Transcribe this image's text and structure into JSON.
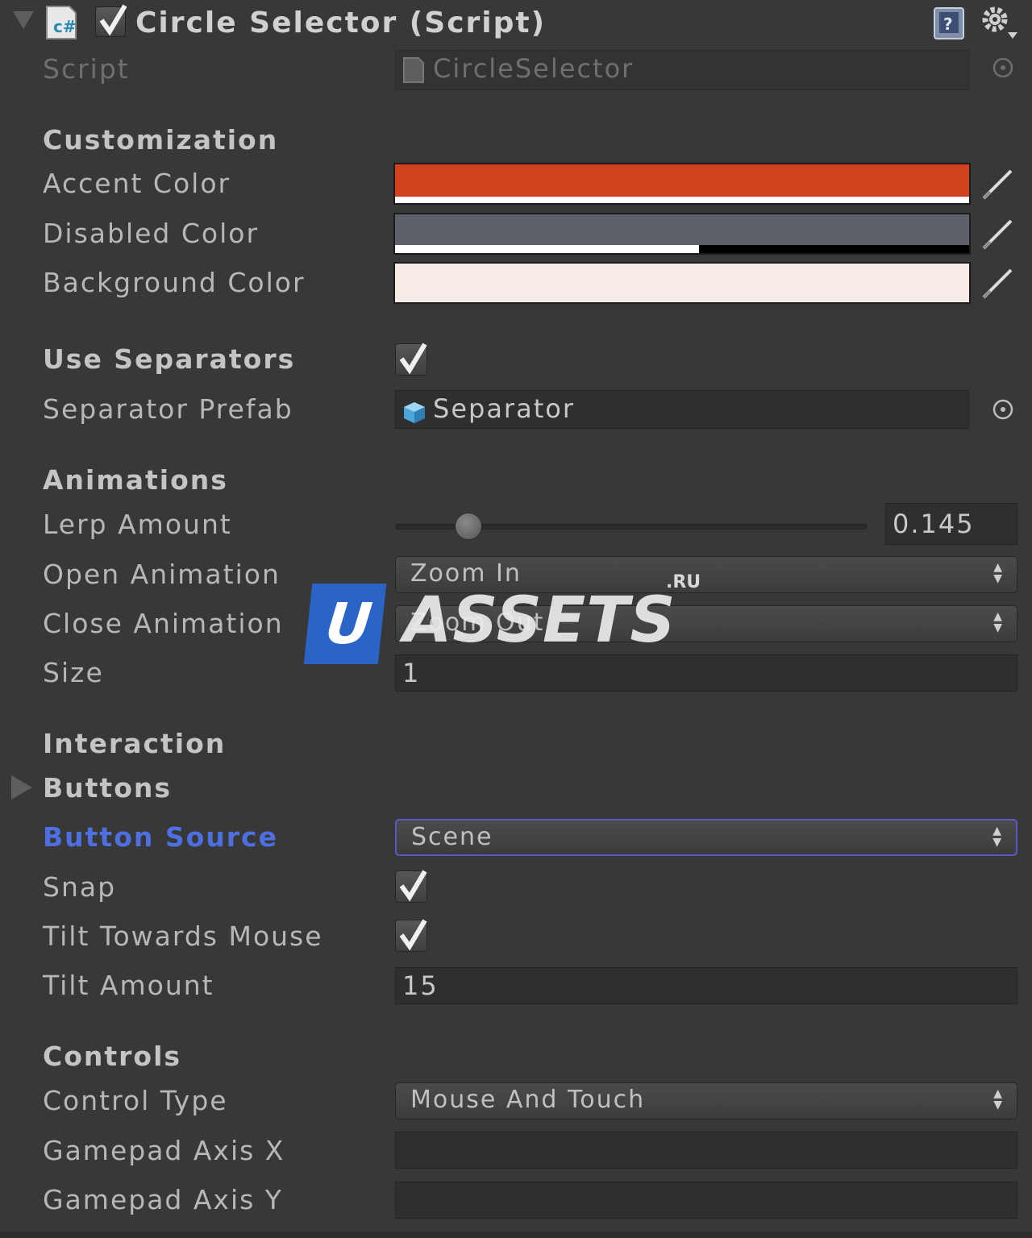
{
  "component": {
    "title": "Circle Selector (Script)",
    "enabled": true,
    "fold_icon": "triangle-down-icon",
    "script_icon": "csharp-script-icon",
    "help_icon": "help-book-icon",
    "settings_icon": "gear-icon"
  },
  "script_field": {
    "label": "Script",
    "value": "CircleSelector"
  },
  "customization": {
    "header": "Customization",
    "accent_color": {
      "label": "Accent Color",
      "color": "#d3421f"
    },
    "disabled_color": {
      "label": "Disabled Color",
      "color": "#5c6068"
    },
    "background_color": {
      "label": "Background Color",
      "color": "#f7ebe8"
    }
  },
  "separators": {
    "use_label": "Use Separators",
    "use_checked": true,
    "prefab_label": "Separator Prefab",
    "prefab_value": "Separator"
  },
  "animations": {
    "header": "Animations",
    "lerp_label": "Lerp Amount",
    "lerp_value": "0.145",
    "open_label": "Open Animation",
    "open_value": "Zoom In",
    "close_label": "Close Animation",
    "close_value": "Zoom Out",
    "size_label": "Size",
    "size_value": "1"
  },
  "interaction": {
    "header": "Interaction",
    "buttons_label": "Buttons",
    "source_label": "Button Source",
    "source_value": "Scene",
    "snap_label": "Snap",
    "snap_checked": true,
    "tilt_label": "Tilt Towards Mouse",
    "tilt_checked": true,
    "tilt_amount_label": "Tilt Amount",
    "tilt_amount_value": "15"
  },
  "controls": {
    "header": "Controls",
    "type_label": "Control Type",
    "type_value": "Mouse And Touch",
    "axis_x_label": "Gamepad Axis X",
    "axis_x_value": "",
    "axis_y_label": "Gamepad Axis Y",
    "axis_y_value": ""
  },
  "watermark": {
    "letter": "U",
    "text": "ASSETS",
    "suffix": ".RU"
  }
}
